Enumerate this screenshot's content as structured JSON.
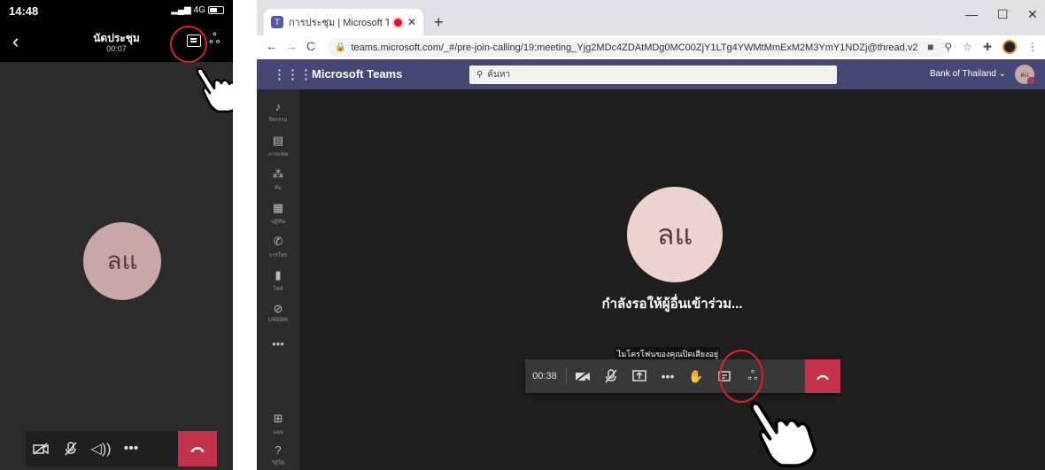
{
  "phone": {
    "status_time": "14:48",
    "network": "4G",
    "meeting_title": "นัดประชุม",
    "meeting_duration": "00:07",
    "avatar_initials": "ลแ",
    "icons": {
      "back": "chevron-left-icon",
      "chat": "chat-icon",
      "participants": "people-icon",
      "camera_off": "camera-off-icon",
      "mic_off": "mic-off-icon",
      "speaker": "speaker-icon",
      "more": "more-icon",
      "hang_up": "hang-up-icon"
    }
  },
  "browser": {
    "tab_title": "การประชุม | Microsoft Teams",
    "url": "teams.microsoft.com/_#/pre-join-calling/19:meeting_Yjg2MDc4ZDAtMDg0MC00ZjY1LTg4YWMtMmExM2M3YmY1NDZj@thread.v2"
  },
  "teams": {
    "brand": "Microsoft Teams",
    "search_placeholder": "ค้นหา",
    "org_name": "Bank of Thailand",
    "user_initials": "ลแ",
    "rail": [
      {
        "icon": "bell-icon",
        "label": "กิจกรรม"
      },
      {
        "icon": "chat-icon",
        "label": "การแชท"
      },
      {
        "icon": "teams-icon",
        "label": "ทีม"
      },
      {
        "icon": "calendar-icon",
        "label": "ปฏิทิน"
      },
      {
        "icon": "phone-icon",
        "label": "การโทร"
      },
      {
        "icon": "file-icon",
        "label": "ไฟล์"
      },
      {
        "icon": "check-icon",
        "label": "LMS365"
      },
      {
        "icon": "more-icon",
        "label": ""
      }
    ],
    "rail_bottom": [
      {
        "icon": "apps-icon",
        "label": "แอป"
      },
      {
        "icon": "help-icon",
        "label": "วิธีใช้"
      }
    ],
    "avatar_initials": "ลแ",
    "waiting_text": "กำลังรอให้ผู้อื่นเข้าร่วม...",
    "tooltip": "ไมโครโฟนของคุณปิดเสียงอยู่",
    "call_duration": "00:38"
  },
  "colors": {
    "teams_header": "#464775",
    "hang_up": "#c4314b",
    "highlight_circle": "#e02020"
  }
}
